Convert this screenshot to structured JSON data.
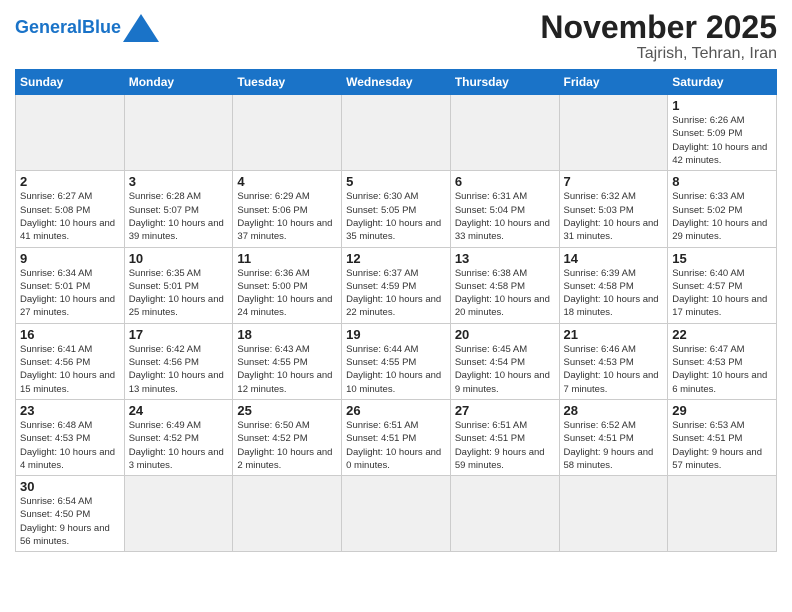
{
  "logo": {
    "text_general": "General",
    "text_blue": "Blue"
  },
  "header": {
    "title": "November 2025",
    "subtitle": "Tajrish, Tehran, Iran"
  },
  "weekdays": [
    "Sunday",
    "Monday",
    "Tuesday",
    "Wednesday",
    "Thursday",
    "Friday",
    "Saturday"
  ],
  "weeks": [
    [
      {
        "day": "",
        "empty": true
      },
      {
        "day": "",
        "empty": true
      },
      {
        "day": "",
        "empty": true
      },
      {
        "day": "",
        "empty": true
      },
      {
        "day": "",
        "empty": true
      },
      {
        "day": "",
        "empty": true
      },
      {
        "day": "1",
        "sunrise": "6:26 AM",
        "sunset": "5:09 PM",
        "daylight": "10 hours and 42 minutes."
      }
    ],
    [
      {
        "day": "2",
        "sunrise": "6:27 AM",
        "sunset": "5:08 PM",
        "daylight": "10 hours and 41 minutes."
      },
      {
        "day": "3",
        "sunrise": "6:28 AM",
        "sunset": "5:07 PM",
        "daylight": "10 hours and 39 minutes."
      },
      {
        "day": "4",
        "sunrise": "6:29 AM",
        "sunset": "5:06 PM",
        "daylight": "10 hours and 37 minutes."
      },
      {
        "day": "5",
        "sunrise": "6:30 AM",
        "sunset": "5:05 PM",
        "daylight": "10 hours and 35 minutes."
      },
      {
        "day": "6",
        "sunrise": "6:31 AM",
        "sunset": "5:04 PM",
        "daylight": "10 hours and 33 minutes."
      },
      {
        "day": "7",
        "sunrise": "6:32 AM",
        "sunset": "5:03 PM",
        "daylight": "10 hours and 31 minutes."
      },
      {
        "day": "8",
        "sunrise": "6:33 AM",
        "sunset": "5:02 PM",
        "daylight": "10 hours and 29 minutes."
      }
    ],
    [
      {
        "day": "9",
        "sunrise": "6:34 AM",
        "sunset": "5:01 PM",
        "daylight": "10 hours and 27 minutes."
      },
      {
        "day": "10",
        "sunrise": "6:35 AM",
        "sunset": "5:01 PM",
        "daylight": "10 hours and 25 minutes."
      },
      {
        "day": "11",
        "sunrise": "6:36 AM",
        "sunset": "5:00 PM",
        "daylight": "10 hours and 24 minutes."
      },
      {
        "day": "12",
        "sunrise": "6:37 AM",
        "sunset": "4:59 PM",
        "daylight": "10 hours and 22 minutes."
      },
      {
        "day": "13",
        "sunrise": "6:38 AM",
        "sunset": "4:58 PM",
        "daylight": "10 hours and 20 minutes."
      },
      {
        "day": "14",
        "sunrise": "6:39 AM",
        "sunset": "4:58 PM",
        "daylight": "10 hours and 18 minutes."
      },
      {
        "day": "15",
        "sunrise": "6:40 AM",
        "sunset": "4:57 PM",
        "daylight": "10 hours and 17 minutes."
      }
    ],
    [
      {
        "day": "16",
        "sunrise": "6:41 AM",
        "sunset": "4:56 PM",
        "daylight": "10 hours and 15 minutes."
      },
      {
        "day": "17",
        "sunrise": "6:42 AM",
        "sunset": "4:56 PM",
        "daylight": "10 hours and 13 minutes."
      },
      {
        "day": "18",
        "sunrise": "6:43 AM",
        "sunset": "4:55 PM",
        "daylight": "10 hours and 12 minutes."
      },
      {
        "day": "19",
        "sunrise": "6:44 AM",
        "sunset": "4:55 PM",
        "daylight": "10 hours and 10 minutes."
      },
      {
        "day": "20",
        "sunrise": "6:45 AM",
        "sunset": "4:54 PM",
        "daylight": "10 hours and 9 minutes."
      },
      {
        "day": "21",
        "sunrise": "6:46 AM",
        "sunset": "4:53 PM",
        "daylight": "10 hours and 7 minutes."
      },
      {
        "day": "22",
        "sunrise": "6:47 AM",
        "sunset": "4:53 PM",
        "daylight": "10 hours and 6 minutes."
      }
    ],
    [
      {
        "day": "23",
        "sunrise": "6:48 AM",
        "sunset": "4:53 PM",
        "daylight": "10 hours and 4 minutes."
      },
      {
        "day": "24",
        "sunrise": "6:49 AM",
        "sunset": "4:52 PM",
        "daylight": "10 hours and 3 minutes."
      },
      {
        "day": "25",
        "sunrise": "6:50 AM",
        "sunset": "4:52 PM",
        "daylight": "10 hours and 2 minutes."
      },
      {
        "day": "26",
        "sunrise": "6:51 AM",
        "sunset": "4:51 PM",
        "daylight": "10 hours and 0 minutes."
      },
      {
        "day": "27",
        "sunrise": "6:51 AM",
        "sunset": "4:51 PM",
        "daylight": "9 hours and 59 minutes."
      },
      {
        "day": "28",
        "sunrise": "6:52 AM",
        "sunset": "4:51 PM",
        "daylight": "9 hours and 58 minutes."
      },
      {
        "day": "29",
        "sunrise": "6:53 AM",
        "sunset": "4:51 PM",
        "daylight": "9 hours and 57 minutes."
      }
    ],
    [
      {
        "day": "30",
        "sunrise": "6:54 AM",
        "sunset": "4:50 PM",
        "daylight": "9 hours and 56 minutes."
      },
      {
        "day": "",
        "empty": true
      },
      {
        "day": "",
        "empty": true
      },
      {
        "day": "",
        "empty": true
      },
      {
        "day": "",
        "empty": true
      },
      {
        "day": "",
        "empty": true
      },
      {
        "day": "",
        "empty": true
      }
    ]
  ]
}
